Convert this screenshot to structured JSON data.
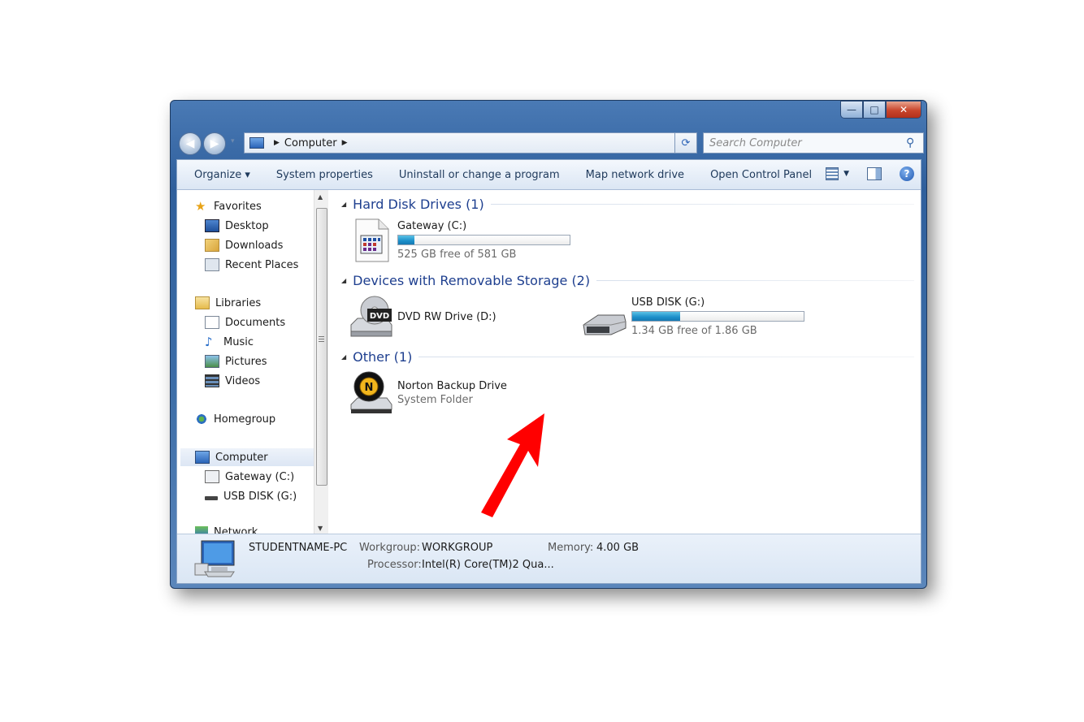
{
  "window": {
    "caption": {
      "min": "—",
      "max": "□",
      "close": "✕"
    }
  },
  "nav": {
    "back": "◀",
    "forward": "▶",
    "address_path": [
      "Computer"
    ],
    "search_placeholder": "Search Computer"
  },
  "toolbar": {
    "organize": "Organize ▾",
    "system_properties": "System properties",
    "uninstall": "Uninstall or change a program",
    "map_drive": "Map network drive",
    "control_panel": "Open Control Panel",
    "help": "?"
  },
  "sidebar": {
    "favorites": {
      "label": "Favorites",
      "items": [
        "Desktop",
        "Downloads",
        "Recent Places"
      ]
    },
    "libraries": {
      "label": "Libraries",
      "items": [
        "Documents",
        "Music",
        "Pictures",
        "Videos"
      ]
    },
    "homegroup": "Homegroup",
    "computer": {
      "label": "Computer",
      "items": [
        "Gateway (C:)",
        "USB DISK (G:)"
      ]
    },
    "network": "Network"
  },
  "groups": {
    "hdd": {
      "title": "Hard Disk Drives (1)",
      "drives": [
        {
          "name": "Gateway (C:)",
          "free": "525 GB free of 581 GB",
          "used_fraction": 0.096
        }
      ]
    },
    "removable": {
      "title": "Devices with Removable Storage (2)",
      "dvd": {
        "name": "DVD RW Drive (D:)",
        "badge": "DVD"
      },
      "usb": {
        "name": "USB DISK (G:)",
        "free": "1.34 GB free of 1.86 GB",
        "used_fraction": 0.28
      }
    },
    "other": {
      "title": "Other (1)",
      "items": [
        {
          "name": "Norton Backup Drive",
          "type": "System Folder",
          "badge": "N"
        }
      ]
    }
  },
  "status": {
    "computer_name": "STUDENTNAME-PC",
    "workgroup_label": "Workgroup:",
    "workgroup": "WORKGROUP",
    "memory_label": "Memory:",
    "memory": "4.00 GB",
    "processor_label": "Processor:",
    "processor": "Intel(R) Core(TM)2 Qua..."
  },
  "annotation": {
    "arrow_color": "#ff0000"
  }
}
